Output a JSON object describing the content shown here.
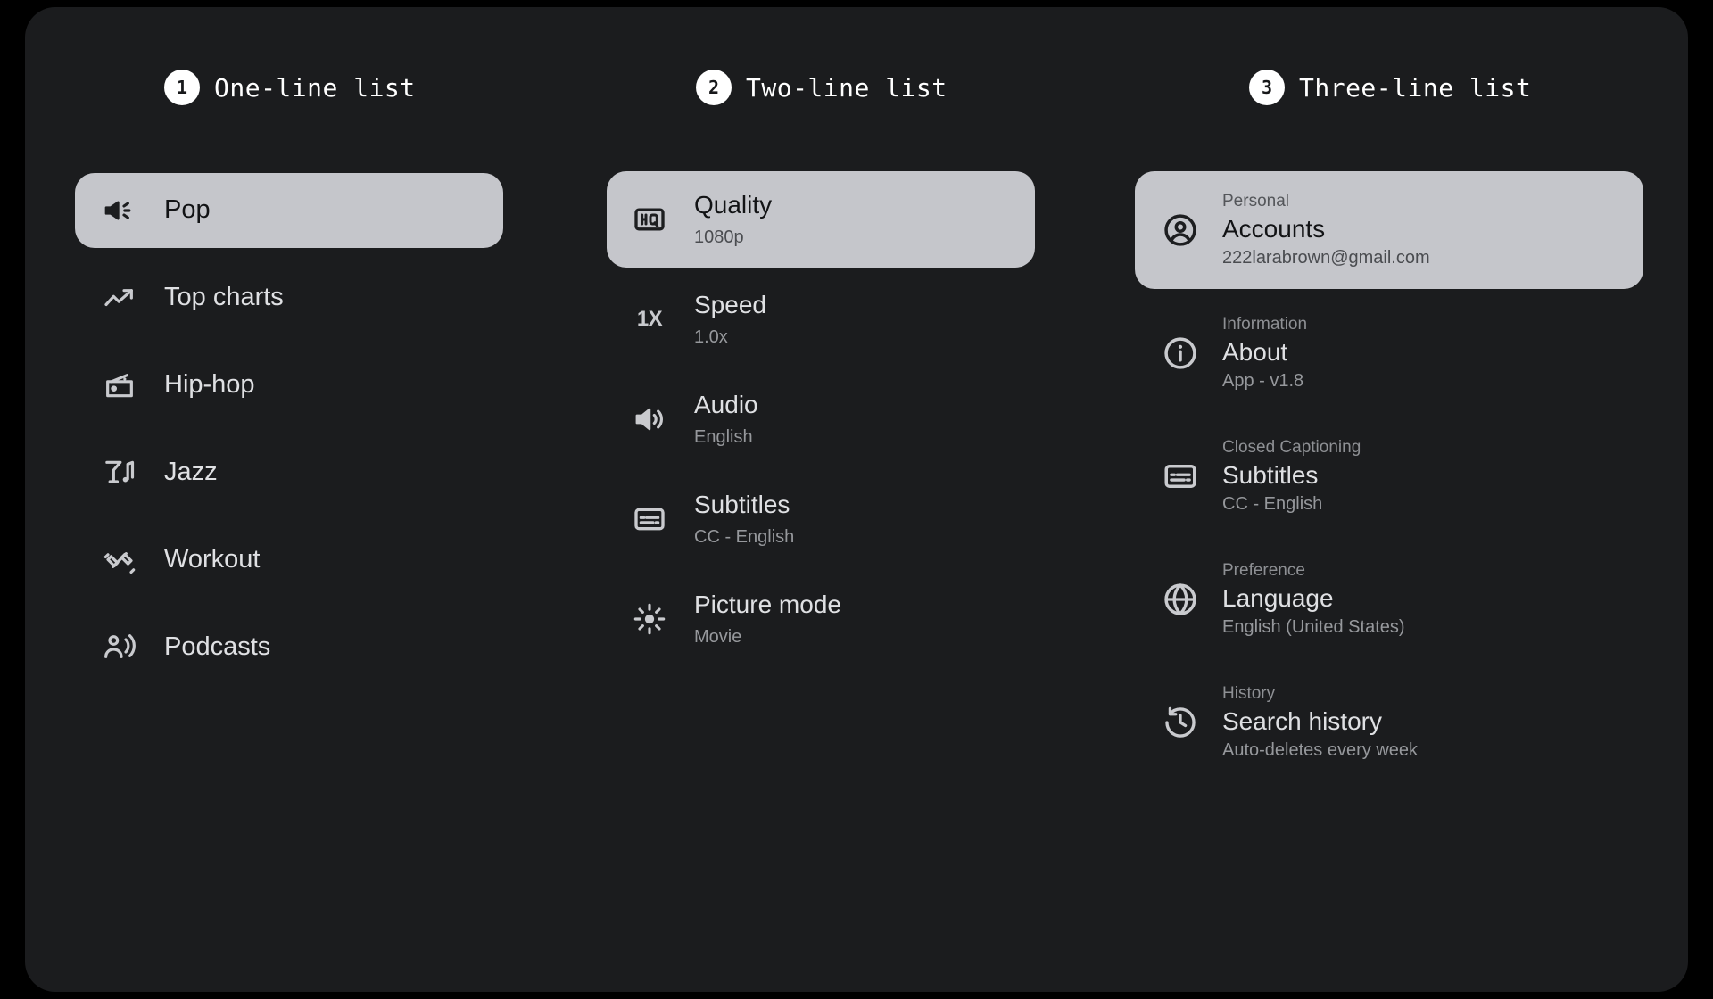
{
  "columns": [
    {
      "badge": "1",
      "title": "One-line list",
      "items": [
        {
          "icon": "campaign-icon",
          "headline": "Pop",
          "selected": true
        },
        {
          "icon": "trending-up-icon",
          "headline": "Top charts",
          "selected": false
        },
        {
          "icon": "radio-icon",
          "headline": "Hip-hop",
          "selected": false
        },
        {
          "icon": "nightlife-icon",
          "headline": "Jazz",
          "selected": false
        },
        {
          "icon": "fitness-icon",
          "headline": "Workout",
          "selected": false
        },
        {
          "icon": "podcasts-icon",
          "headline": "Podcasts",
          "selected": false
        }
      ]
    },
    {
      "badge": "2",
      "title": "Two-line list",
      "items": [
        {
          "icon": "hq-icon",
          "headline": "Quality",
          "support": "1080p",
          "selected": true
        },
        {
          "icon": "speed-1x-icon",
          "headline": "Speed",
          "support": "1.0x",
          "selected": false
        },
        {
          "icon": "volume-up-icon",
          "headline": "Audio",
          "support": "English",
          "selected": false
        },
        {
          "icon": "subtitles-icon",
          "headline": "Subtitles",
          "support": "CC - English",
          "selected": false
        },
        {
          "icon": "brightness-icon",
          "headline": "Picture mode",
          "support": "Movie",
          "selected": false
        }
      ]
    },
    {
      "badge": "3",
      "title": "Three-line list",
      "items": [
        {
          "icon": "account-circle-icon",
          "overline": "Personal",
          "headline": "Accounts",
          "support": "222larabrown@gmail.com",
          "selected": true
        },
        {
          "icon": "info-icon",
          "overline": "Information",
          "headline": "About",
          "support": "App - v1.8",
          "selected": false
        },
        {
          "icon": "subtitles-icon",
          "overline": "Closed Captioning",
          "headline": "Subtitles",
          "support": "CC - English",
          "selected": false
        },
        {
          "icon": "language-icon",
          "overline": "Preference",
          "headline": "Language",
          "support": "English (United States)",
          "selected": false
        },
        {
          "icon": "history-icon",
          "overline": "History",
          "headline": "Search history",
          "support": "Auto-deletes every week",
          "selected": false
        }
      ]
    }
  ],
  "speed_icon_label": "1X",
  "colors": {
    "page_background": "#000000",
    "canvas_background": "#1b1c1e",
    "selected_background": "#c5c6cb",
    "headline": "#dfe0e3",
    "support": "#96989c",
    "overline": "#8e9094",
    "badge_background": "#ffffff",
    "badge_text": "#17181a"
  }
}
